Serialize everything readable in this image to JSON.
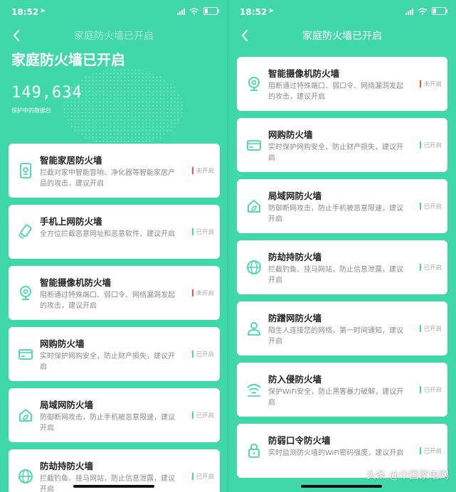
{
  "status": {
    "time": "18:52",
    "location_icon": "location-arrow-icon"
  },
  "left": {
    "nav_title": "家庭防火墙已开启",
    "big_title": "家庭防火墙已开启",
    "counter": "149,634",
    "counter_label": "保护中的数据包",
    "cards": [
      {
        "icon": "smart-home-icon",
        "title": "智能家居防火墙",
        "desc": "拦截对家中智能音响、净化器等智能家居产品的攻击，建议开启",
        "status": "未开启",
        "on": false
      },
      {
        "icon": "phone-shield-icon",
        "title": "手机上网防火墙",
        "desc": "全方位拦截恶意网址和恶意软件，建议开启",
        "status": "已开启",
        "on": true
      },
      {
        "icon": "camera-icon",
        "title": "智能摄像机防火墙",
        "desc": "阻断通过特殊端口、弱口令、网络漏洞发起的攻击，建议开启",
        "status": "未开启",
        "on": false
      },
      {
        "icon": "card-icon",
        "title": "网购防火墙",
        "desc": "实时保护网购安全，防止财产损失，建议开启",
        "status": "已开启",
        "on": true
      },
      {
        "icon": "house-leaf-icon",
        "title": "局域网防火墙",
        "desc": "防御断网攻击，防止手机被恶意限速，建议开启",
        "status": "已开启",
        "on": true
      },
      {
        "icon": "globe-icon",
        "title": "防劫持防火墙",
        "desc": "拦截钓鱼、挂马网站，防止信息泄露，建议开启",
        "status": "已开启",
        "on": true
      }
    ]
  },
  "right": {
    "nav_title": "家庭防火墙已开启",
    "cards": [
      {
        "icon": "camera-icon",
        "title": "智能摄像机防火墙",
        "desc": "阻断通过特殊端口、弱口令、网络漏洞发起的攻击，建议开启",
        "status": "未开启",
        "on": false
      },
      {
        "icon": "card-icon",
        "title": "网购防火墙",
        "desc": "实时保护网购安全，防止财产损失，建议开启",
        "status": "已开启",
        "on": true
      },
      {
        "icon": "house-leaf-icon",
        "title": "局域网防火墙",
        "desc": "防御断网攻击，防止手机被恶意限速，建议开启",
        "status": "已开启",
        "on": true
      },
      {
        "icon": "globe-icon",
        "title": "防劫持防火墙",
        "desc": "拦截钓鱼、挂马网站，防止信息泄露，建议开启",
        "status": "已开启",
        "on": true
      },
      {
        "icon": "user-icon",
        "title": "防蹭网防火墙",
        "desc": "陌生人连接您的网络，第一时间通知，建议开启",
        "status": "已开启",
        "on": true
      },
      {
        "icon": "wifi-icon",
        "title": "防入侵防火墙",
        "desc": "保护WiFi安全，防止黑客暴力破解，建议开启",
        "status": "已开启",
        "on": true
      },
      {
        "icon": "lock-icon",
        "title": "防弱口令防火墙",
        "desc": "实时监测防火墙的WiFi密码强度，建议开启",
        "status": "已开启",
        "on": true
      }
    ]
  },
  "watermark": "头条 @中国家电网",
  "colors": {
    "accent": "#3fd8a6",
    "off": "#e8583a"
  }
}
